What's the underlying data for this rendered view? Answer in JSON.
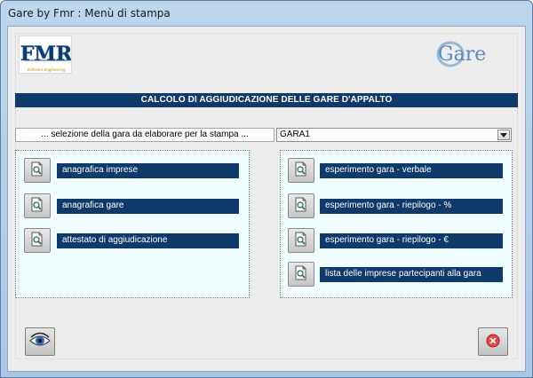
{
  "window": {
    "title": "Gare by Fmr : Menù di stampa"
  },
  "logos": {
    "fmr_text": "FMR",
    "fmr_caption": "Software Engineering",
    "gare_text": "Gare"
  },
  "banner": {
    "title": "CALCOLO DI AGGIUDICAZIONE DELLE GARE D'APPALTO"
  },
  "selection": {
    "label": "... selezione della gara da elaborare per la stampa ...",
    "value": "GARA1"
  },
  "left_panel": {
    "items": [
      {
        "label": "anagrafica imprese"
      },
      {
        "label": "anagrafica gare"
      },
      {
        "label": "attestato di aggiudicazione"
      }
    ]
  },
  "right_panel": {
    "items": [
      {
        "label": "esperimento gara - verbale"
      },
      {
        "label": "esperimento gara - riepilogo  -  %"
      },
      {
        "label": "esperimento gara - riepilogo  -  €"
      },
      {
        "label": "lista delle imprese partecipanti alla gara"
      }
    ]
  },
  "colors": {
    "title_bar": "#bcd6ee",
    "navy": "#0e3a6b",
    "panel_bg": "#f0feff",
    "client_bg": "#ececec"
  },
  "icons": {
    "report_button": "magnifier-document-icon",
    "preview": "eye-icon",
    "close": "close-icon"
  }
}
